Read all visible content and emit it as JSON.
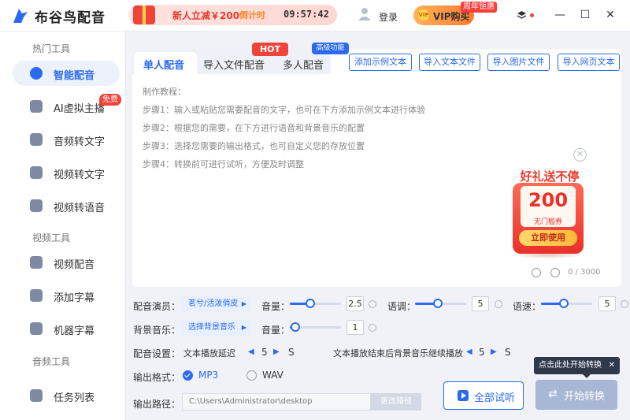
{
  "app": {
    "title": "布谷鸟配音"
  },
  "promo": {
    "main": "新人立减￥200",
    "countdown_label": "倒计时",
    "timer": "09:57:42"
  },
  "header": {
    "login": "登录",
    "vip_button": "VIP购买",
    "vip_badge": "周年钜惠"
  },
  "sidebar": {
    "sections": [
      "热门工具",
      "视频工具",
      "音频工具"
    ],
    "items": [
      {
        "label": "智能配音",
        "icon": "mic-icon"
      },
      {
        "label": "AI虚拟主播",
        "icon": "avatar-icon",
        "badge": "免费"
      },
      {
        "label": "音频转文字",
        "icon": "audio-text-icon"
      },
      {
        "label": "视频转文字",
        "icon": "video-text-icon"
      },
      {
        "label": "视频转语音",
        "icon": "video-voice-icon"
      },
      {
        "label": "视频配音",
        "icon": "video-dub-icon"
      },
      {
        "label": "添加字幕",
        "icon": "subtitle-icon"
      },
      {
        "label": "机器字幕",
        "icon": "robot-icon"
      },
      {
        "label": "任务列表",
        "icon": "list-icon"
      }
    ]
  },
  "tabs": [
    {
      "label": "单人配音"
    },
    {
      "label": "导入文件配音",
      "badge": "HOT"
    },
    {
      "label": "多人配音",
      "badge": "高级功能"
    }
  ],
  "tools": [
    "添加示例文本",
    "导入文本文件",
    "导入图片文件",
    "导入网页文本"
  ],
  "tutorial": [
    "制作教程：",
    "步骤1：输入或粘贴您需要配音的文字，也可在下方添加示例文本进行体验",
    "步骤2：根据您的需要，在下方进行语音和背景音乐的配置",
    "步骤3：选择您需要的输出格式，也可自定义您的存放位置",
    "步骤4：转换前可进行试听，方便及时调整"
  ],
  "counter": "0 / 3000",
  "coupon": {
    "title": "好礼送不停",
    "value": "200",
    "subtitle": "无门槛券",
    "button": "立即使用"
  },
  "settings": {
    "voice_label": "配音演员：",
    "voice_value": "茗兮/活泼俏皮",
    "volume_label": "音量：",
    "volume_value": "2.5",
    "volume_fraction": 0.4,
    "pitch_label": "语调：",
    "pitch_value": "5",
    "pitch_fraction": 0.45,
    "speed_label": "语速：",
    "speed_value": "5",
    "speed_fraction": 0.45,
    "bgm_label": "背景音乐：",
    "bgm_value": "选择背景音乐",
    "bgm_volume_label": "音量：",
    "bgm_volume_value": "1",
    "bgm_volume_fraction": 0.1,
    "config_label": "配音设置：",
    "delay_label": "文本播放延迟",
    "delay_value": "5",
    "delay_unit": "S",
    "continue_label": "文本播放结束后背景音乐继续播放",
    "continue_value": "5",
    "continue_unit": "S",
    "format_label": "输出格式：",
    "format_options": [
      "MP3",
      "WAV"
    ],
    "format_selected": "MP3",
    "path_label": "输出路径：",
    "path_value": "C:\\Users\\Administrator\\desktop",
    "path_button": "更改路径"
  },
  "actions": {
    "try": "全部试听",
    "start": "开始转换",
    "tip": "点击此处开始转换"
  },
  "colors": {
    "accent": "#2b6af0",
    "hot": "#f0433a"
  }
}
